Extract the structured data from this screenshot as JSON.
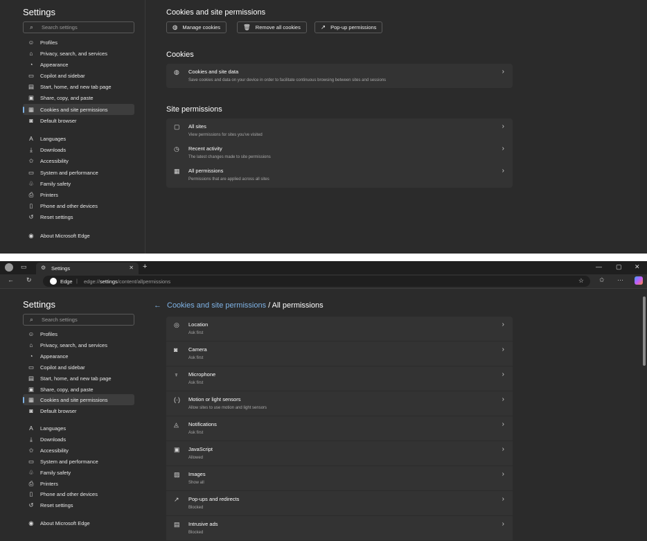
{
  "top": {
    "sidebar": {
      "title": "Settings",
      "search_placeholder": "Search settings",
      "items": [
        {
          "label": "Profiles",
          "icon": "profile-icon"
        },
        {
          "label": "Privacy, search, and services",
          "icon": "lock-icon"
        },
        {
          "label": "Appearance",
          "icon": "appearance-icon"
        },
        {
          "label": "Copilot and sidebar",
          "icon": "sidebar-icon"
        },
        {
          "label": "Start, home, and new tab page",
          "icon": "home-icon"
        },
        {
          "label": "Share, copy, and paste",
          "icon": "share-icon"
        },
        {
          "label": "Cookies and site permissions",
          "icon": "cookie-permissions-icon",
          "active": true
        },
        {
          "label": "Default browser",
          "icon": "browser-icon"
        },
        {
          "label": "Languages",
          "icon": "languages-icon"
        },
        {
          "label": "Downloads",
          "icon": "download-icon"
        },
        {
          "label": "Accessibility",
          "icon": "accessibility-icon"
        },
        {
          "label": "System and performance",
          "icon": "laptop-icon"
        },
        {
          "label": "Family safety",
          "icon": "family-icon"
        },
        {
          "label": "Printers",
          "icon": "printer-icon"
        },
        {
          "label": "Phone and other devices",
          "icon": "phone-icon"
        },
        {
          "label": "Reset settings",
          "icon": "reset-icon"
        },
        {
          "label": "About Microsoft Edge",
          "icon": "edge-icon"
        }
      ]
    },
    "main": {
      "title": "Cookies and site permissions",
      "buttons": [
        {
          "label": "Manage cookies",
          "icon": "cookie-icon"
        },
        {
          "label": "Remove all cookies",
          "icon": "trash-icon"
        },
        {
          "label": "Pop-up permissions",
          "icon": "external-link-icon"
        }
      ],
      "cookies_heading": "Cookies",
      "cookies_row": {
        "title": "Cookies and site data",
        "subtitle": "Save cookies and data on your device in order to facilitate continuous browsing between sites and sessions"
      },
      "site_permissions_heading": "Site permissions",
      "site_rows": [
        {
          "title": "All sites",
          "subtitle": "View permissions for sites you've visited",
          "icon": "all-sites-icon"
        },
        {
          "title": "Recent activity",
          "subtitle": "The latest changes made to site permissions",
          "icon": "clock-icon"
        },
        {
          "title": "All permissions",
          "subtitle": "Permissions that are applied across all sites",
          "icon": "permissions-icon"
        }
      ]
    }
  },
  "bottom": {
    "tab": {
      "label": "Settings"
    },
    "address": {
      "edge_label": "Edge",
      "url_prefix": "edge://",
      "url_bold": "settings",
      "url_rest": "/content/allpermissions"
    },
    "sidebar": {
      "title": "Settings",
      "search_placeholder": "Search settings"
    },
    "breadcrumb": {
      "link": "Cookies and site permissions",
      "current": "/ All permissions"
    },
    "permissions": [
      {
        "title": "Location",
        "subtitle": "Ask first",
        "icon": "location-icon"
      },
      {
        "title": "Camera",
        "subtitle": "Ask first",
        "icon": "camera-icon"
      },
      {
        "title": "Microphone",
        "subtitle": "Ask first",
        "icon": "microphone-icon"
      },
      {
        "title": "Motion or light sensors",
        "subtitle": "Allow sites to use motion and light sensors",
        "icon": "sensor-icon"
      },
      {
        "title": "Notifications",
        "subtitle": "Ask first",
        "icon": "bell-icon"
      },
      {
        "title": "JavaScript",
        "subtitle": "Allowed",
        "icon": "javascript-icon"
      },
      {
        "title": "Images",
        "subtitle": "Show all",
        "icon": "image-icon"
      },
      {
        "title": "Pop-ups and redirects",
        "subtitle": "Blocked",
        "icon": "popup-icon"
      },
      {
        "title": "Intrusive ads",
        "subtitle": "Blocked",
        "icon": "ads-icon"
      }
    ]
  }
}
